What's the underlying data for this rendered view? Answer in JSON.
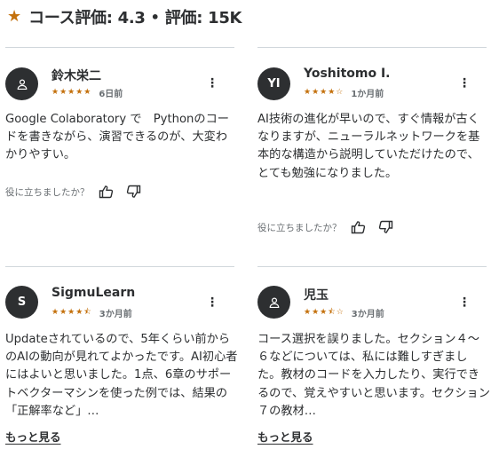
{
  "header": {
    "course_rating": "コース評価: 4.3",
    "separator": "•",
    "rating_count": "評価: 15K"
  },
  "reviews": [
    {
      "avatar_text": "",
      "avatar_icon": "person-icon",
      "name": "鈴木栄二",
      "rating": 5,
      "stars": "★★★★★",
      "time_ago": "6日前",
      "text": "Google Colaboratory で　Pythonのコードを書きながら、演習できるのが、大変わかりやすい。",
      "helpful_prompt": "役に立ちましたか？",
      "show_more": ""
    },
    {
      "avatar_text": "YI",
      "avatar_icon": "",
      "name": "Yoshitomo I.",
      "rating": 4,
      "stars": "★★★★☆",
      "time_ago": "1か月前",
      "text": "AI技術の進化が早いので、すぐ情報が古くなりますが、ニューラルネットワークを基本的な構造から説明していただけたので、とても勉強になりました。",
      "helpful_prompt": "役に立ちましたか？",
      "show_more": ""
    },
    {
      "avatar_text": "S",
      "avatar_icon": "",
      "name": "SigmuLearn",
      "rating": 4.5,
      "stars": "★★★★⯪",
      "time_ago": "3か月前",
      "text": "Updateされているので、5年くらい前からのAIの動向が見れてよかったです。AI初心者にはよいと思いました。1点、6章のサポートベクターマシンを使った例では、結果の「正解率など」…",
      "helpful_prompt": "",
      "show_more": "もっと見る"
    },
    {
      "avatar_text": "",
      "avatar_icon": "person-icon",
      "name": "児玉",
      "rating": 3.5,
      "stars": "★★★⯪☆",
      "time_ago": "3か月前",
      "text": "コース選択を誤りました。セクション４～６などについては、私には難しすぎました。教材のコードを入力したり、実行できるので、覚えやすいと思います。セクション７の教材…",
      "helpful_prompt": "",
      "show_more": "もっと見る"
    }
  ],
  "colors": {
    "star": "#c4710d",
    "text": "#2d2f31",
    "muted": "#6a6f73",
    "avatar_bg": "#2d2f31",
    "divider": "#d1d7dc"
  }
}
